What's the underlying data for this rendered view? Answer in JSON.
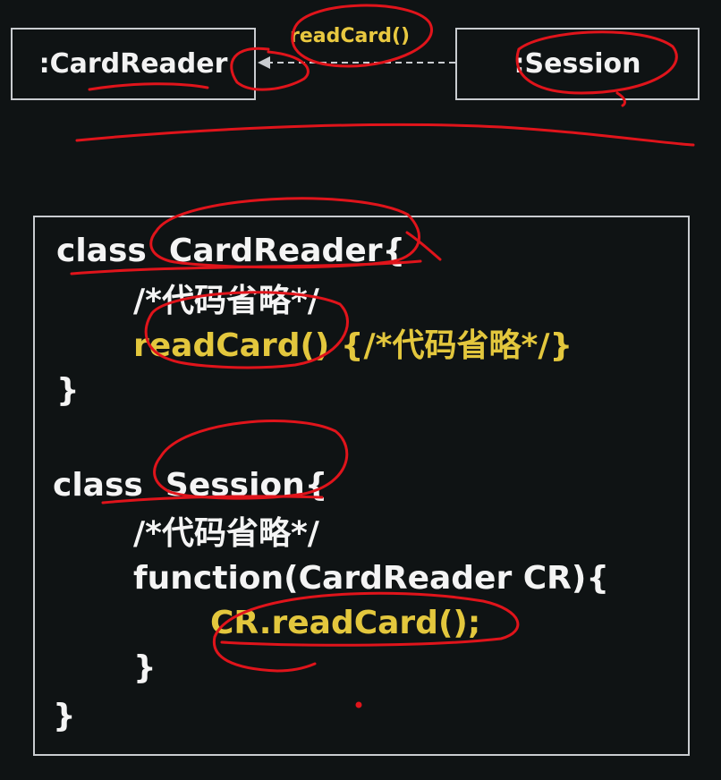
{
  "diagram": {
    "left_object": ":CardReader",
    "right_object": ":Session",
    "message": "readCard()"
  },
  "code": {
    "lines": [
      "class  CardReader{",
      "/*代码省略*/",
      "readCard() {/*代码省略*/}",
      "}",
      "class  Session{",
      "/*代码省略*/",
      "function(CardReader CR){",
      "CR.readCard();",
      "}",
      "}"
    ]
  },
  "colors": {
    "background": "#0f1314",
    "text": "#f4f4f4",
    "highlight_text": "#e3c73d",
    "annotation": "#e0141b"
  }
}
